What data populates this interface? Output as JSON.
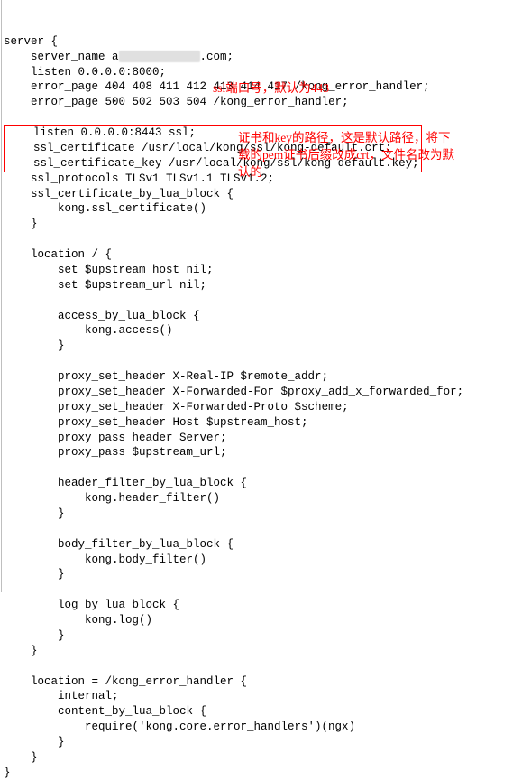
{
  "code": {
    "l1": "server {",
    "l2a": "server_name a",
    "l2b": ".com;",
    "l3": "listen 0.0.0.0:8000;",
    "l4": "error_page 404 408 411 412 413 414 417 /kong_error_handler;",
    "l5": "error_page 500 502 503 504 /kong_error_handler;",
    "l6": "listen 0.0.0.0:8443 ssl;",
    "l7": "ssl_certificate /usr/local/kong/ssl/kong-default.crt;",
    "l8": "ssl_certificate_key /usr/local/kong/ssl/kong-default.key;",
    "l9": "ssl_protocols TLSv1 TLSv1.1 TLSv1.2;",
    "l10": "ssl_certificate_by_lua_block {",
    "l11": "kong.ssl_certificate()",
    "l12": "}",
    "l13": "location / {",
    "l14": "set $upstream_host nil;",
    "l15": "set $upstream_url nil;",
    "l16": "access_by_lua_block {",
    "l17": "kong.access()",
    "l18": "}",
    "l19": "proxy_set_header X-Real-IP $remote_addr;",
    "l20": "proxy_set_header X-Forwarded-For $proxy_add_x_forwarded_for;",
    "l21": "proxy_set_header X-Forwarded-Proto $scheme;",
    "l22": "proxy_set_header Host $upstream_host;",
    "l23": "proxy_pass_header Server;",
    "l24": "proxy_pass $upstream_url;",
    "l25": "header_filter_by_lua_block {",
    "l26": "kong.header_filter()",
    "l27": "}",
    "l28": "body_filter_by_lua_block {",
    "l29": "kong.body_filter()",
    "l30": "}",
    "l31": "log_by_lua_block {",
    "l32": "kong.log()",
    "l33": "}",
    "l34": "}",
    "l35": "location = /kong_error_handler {",
    "l36": "internal;",
    "l37": "content_by_lua_block {",
    "l38": "require('kong.core.error_handlers')(ngx)",
    "l39": "}",
    "l40": "}",
    "l41": "}"
  },
  "annotations": {
    "port": "ssl端口号，默认为443",
    "cert": "证书和key的路径，这是默认路径，将下载的pem证书后缀改成crt，文件名改为默认的"
  }
}
